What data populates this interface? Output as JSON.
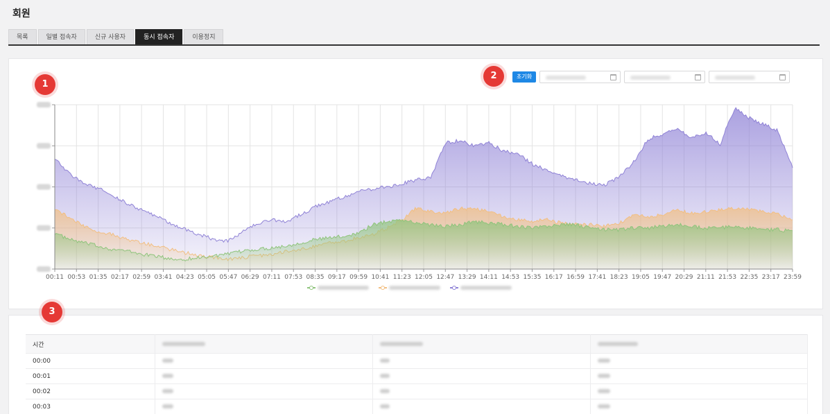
{
  "page": {
    "title": "회원"
  },
  "tabs": [
    {
      "label": "목록",
      "active": false
    },
    {
      "label": "일별 접속자",
      "active": false
    },
    {
      "label": "신규 사용자",
      "active": false
    },
    {
      "label": "동시 접속자",
      "active": true
    },
    {
      "label": "이용정지",
      "active": false
    }
  ],
  "markers": {
    "chart": "1",
    "controls": "2",
    "table": "3"
  },
  "controls": {
    "reset_label": "초기화"
  },
  "colors": {
    "series1": "#8fc47c",
    "series2": "#f2bf82",
    "series3": "#8f82d6",
    "reset_button": "#1e88e5",
    "marker": "#e53935"
  },
  "chart_data": {
    "type": "area",
    "x_tick_labels": [
      "00:11",
      "00:53",
      "01:35",
      "02:17",
      "02:59",
      "03:41",
      "04:23",
      "05:05",
      "05:47",
      "06:29",
      "07:11",
      "07:53",
      "08:35",
      "09:17",
      "09:59",
      "10:41",
      "11:23",
      "12:05",
      "12:47",
      "13:29",
      "14:11",
      "14:53",
      "15:35",
      "16:17",
      "16:59",
      "17:41",
      "18:23",
      "19:05",
      "19:47",
      "20:29",
      "21:11",
      "21:53",
      "22:35",
      "23:17",
      "23:59"
    ],
    "ylim": [
      0,
      100
    ],
    "grid": true,
    "legend_position": "bottom",
    "series": [
      {
        "values": [
          22,
          18,
          16,
          14,
          12,
          11,
          9,
          8,
          6,
          6,
          7,
          8,
          9,
          11,
          12,
          13,
          14,
          16,
          18,
          19,
          20,
          22,
          27,
          29,
          30,
          28,
          27,
          26,
          27,
          29,
          28,
          27,
          26,
          25,
          26,
          27,
          27,
          25,
          24,
          24,
          25,
          25,
          26,
          27,
          26,
          25,
          25,
          26,
          25,
          24,
          24,
          23
        ]
      },
      {
        "values": [
          37,
          31,
          26,
          23,
          21,
          18,
          16,
          14,
          12,
          10,
          8,
          7,
          6,
          7,
          8,
          9,
          11,
          12,
          14,
          16,
          17,
          19,
          21,
          25,
          30,
          37,
          35,
          34,
          37,
          37,
          35,
          32,
          30,
          29,
          30,
          28,
          27,
          27,
          26,
          28,
          33,
          32,
          33,
          36,
          34,
          35,
          36,
          37,
          36,
          35,
          34,
          29
        ]
      },
      {
        "values": [
          68,
          58,
          52,
          49,
          45,
          40,
          36,
          32,
          28,
          24,
          21,
          18,
          17,
          23,
          28,
          30,
          29,
          33,
          38,
          41,
          44,
          47,
          49,
          50,
          52,
          54,
          56,
          77,
          78,
          75,
          77,
          72,
          70,
          64,
          60,
          57,
          54,
          52,
          51,
          56,
          65,
          79,
          82,
          85,
          80,
          83,
          76,
          98,
          92,
          88,
          84,
          62
        ]
      }
    ]
  },
  "table": {
    "headers": [
      "시간"
    ],
    "rows": [
      {
        "time": "00:00"
      },
      {
        "time": "00:01"
      },
      {
        "time": "00:02"
      },
      {
        "time": "00:03"
      }
    ]
  }
}
